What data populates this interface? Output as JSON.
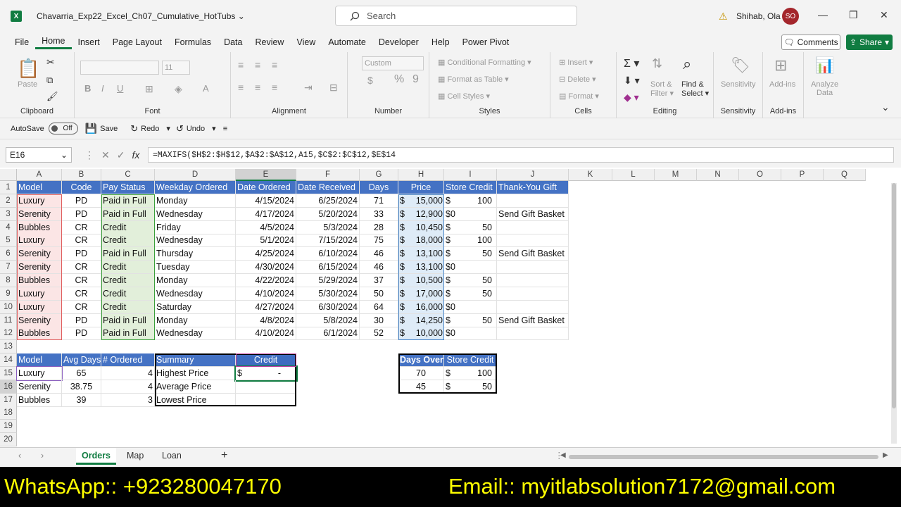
{
  "app": {
    "title": "Chavarria_Exp22_Excel_Ch07_Cumulative_HotTubs",
    "search_placeholder": "Search",
    "user": "Shihab, Ola",
    "initials": "SO"
  },
  "menu": [
    "File",
    "Home",
    "Insert",
    "Page Layout",
    "Formulas",
    "Data",
    "Review",
    "View",
    "Automate",
    "Developer",
    "Help",
    "Power Pivot"
  ],
  "buttons": {
    "comments": "Comments",
    "share": "Share"
  },
  "ribbon": {
    "clipboard": {
      "label": "Clipboard",
      "paste": "Paste"
    },
    "font": {
      "label": "Font",
      "size": "11"
    },
    "alignment": {
      "label": "Alignment"
    },
    "number": {
      "label": "Number",
      "format": "Custom"
    },
    "styles": {
      "label": "Styles",
      "items": [
        "Conditional Formatting",
        "Format as Table",
        "Cell Styles"
      ]
    },
    "cells": {
      "label": "Cells",
      "items": [
        "Insert",
        "Delete",
        "Format"
      ]
    },
    "editing": {
      "label": "Editing",
      "sort": "Sort &",
      "filter": "Filter",
      "find": "Find &",
      "select": "Select"
    },
    "sensitivity": {
      "label": "Sensitivity",
      "btn": "Sensitivity"
    },
    "addins": {
      "label": "Add-ins",
      "btn": "Add-ins"
    },
    "analyze": {
      "line1": "Analyze",
      "line2": "Data"
    }
  },
  "qat": {
    "autosave": "AutoSave",
    "off": "Off",
    "save": "Save",
    "redo": "Redo",
    "undo": "Undo"
  },
  "formula": {
    "namebox": "E16",
    "text": "=MAXIFS($H$2:$H$12,$A$2:$A$12,A15,$C$2:$C$12,$E$14"
  },
  "columns": [
    "A",
    "B",
    "C",
    "D",
    "E",
    "F",
    "G",
    "H",
    "I",
    "J",
    "K",
    "L",
    "M",
    "N",
    "O",
    "P",
    "Q"
  ],
  "rows": [
    "1",
    "2",
    "3",
    "4",
    "5",
    "6",
    "7",
    "8",
    "9",
    "10",
    "11",
    "12",
    "13",
    "14",
    "15",
    "16",
    "17",
    "18",
    "19",
    "20"
  ],
  "table": {
    "headers": [
      "Model",
      "Code",
      "Pay Status",
      "Weekday Ordered",
      "Date Ordered",
      "Date Received",
      "Days",
      "Price",
      "Store Credit",
      "Thank-You Gift"
    ],
    "rows": [
      [
        "Luxury",
        "PD",
        "Paid in Full",
        "Monday",
        "4/15/2024",
        "6/25/2024",
        "71",
        "$",
        "15,000",
        "$",
        "100",
        ""
      ],
      [
        "Serenity",
        "PD",
        "Paid in Full",
        "Wednesday",
        "4/17/2024",
        "5/20/2024",
        "33",
        "$",
        "12,900",
        "$0",
        "",
        "Send Gift Basket"
      ],
      [
        "Bubbles",
        "CR",
        "Credit",
        "Friday",
        "4/5/2024",
        "5/3/2024",
        "28",
        "$",
        "10,450",
        "$",
        "50",
        ""
      ],
      [
        "Luxury",
        "CR",
        "Credit",
        "Wednesday",
        "5/1/2024",
        "7/15/2024",
        "75",
        "$",
        "18,000",
        "$",
        "100",
        ""
      ],
      [
        "Serenity",
        "PD",
        "Paid in Full",
        "Thursday",
        "4/25/2024",
        "6/10/2024",
        "46",
        "$",
        "13,100",
        "$",
        "50",
        "Send Gift Basket"
      ],
      [
        "Serenity",
        "CR",
        "Credit",
        "Tuesday",
        "4/30/2024",
        "6/15/2024",
        "46",
        "$",
        "13,100",
        "$0",
        "",
        ""
      ],
      [
        "Bubbles",
        "CR",
        "Credit",
        "Monday",
        "4/22/2024",
        "5/29/2024",
        "37",
        "$",
        "10,500",
        "$",
        "50",
        ""
      ],
      [
        "Luxury",
        "CR",
        "Credit",
        "Wednesday",
        "4/10/2024",
        "5/30/2024",
        "50",
        "$",
        "17,000",
        "$",
        "50",
        ""
      ],
      [
        "Luxury",
        "CR",
        "Credit",
        "Saturday",
        "4/27/2024",
        "6/30/2024",
        "64",
        "$",
        "16,000",
        "$0",
        "",
        ""
      ],
      [
        "Serenity",
        "PD",
        "Paid in Full",
        "Monday",
        "4/8/2024",
        "5/8/2024",
        "30",
        "$",
        "14,250",
        "$",
        "50",
        "Send Gift Basket"
      ],
      [
        "Bubbles",
        "PD",
        "Paid in Full",
        "Wednesday",
        "4/10/2024",
        "6/1/2024",
        "52",
        "$",
        "10,000",
        "$0",
        "",
        ""
      ]
    ]
  },
  "summary": {
    "headers": [
      "Model",
      "Avg Days",
      "# Ordered",
      "Summary",
      "Credit"
    ],
    "rows": [
      [
        "Luxury",
        "65",
        "4",
        "Highest Price",
        "$",
        "-"
      ],
      [
        "Serenity",
        "38.75",
        "4",
        "Average Price",
        "",
        ""
      ],
      [
        "Bubbles",
        "39",
        "3",
        "Lowest Price",
        "",
        ""
      ]
    ]
  },
  "credit_lookup": {
    "headers": [
      "Days Over",
      "Store Credit"
    ],
    "rows": [
      [
        "70",
        "$",
        "100"
      ],
      [
        "45",
        "$",
        "50"
      ]
    ]
  },
  "tabs": [
    "Orders",
    "Map",
    "Loan"
  ],
  "banner": {
    "left": "WhatsApp:: +923280047170",
    "right": "Email:: myitlabsolution7172@gmail.com"
  }
}
